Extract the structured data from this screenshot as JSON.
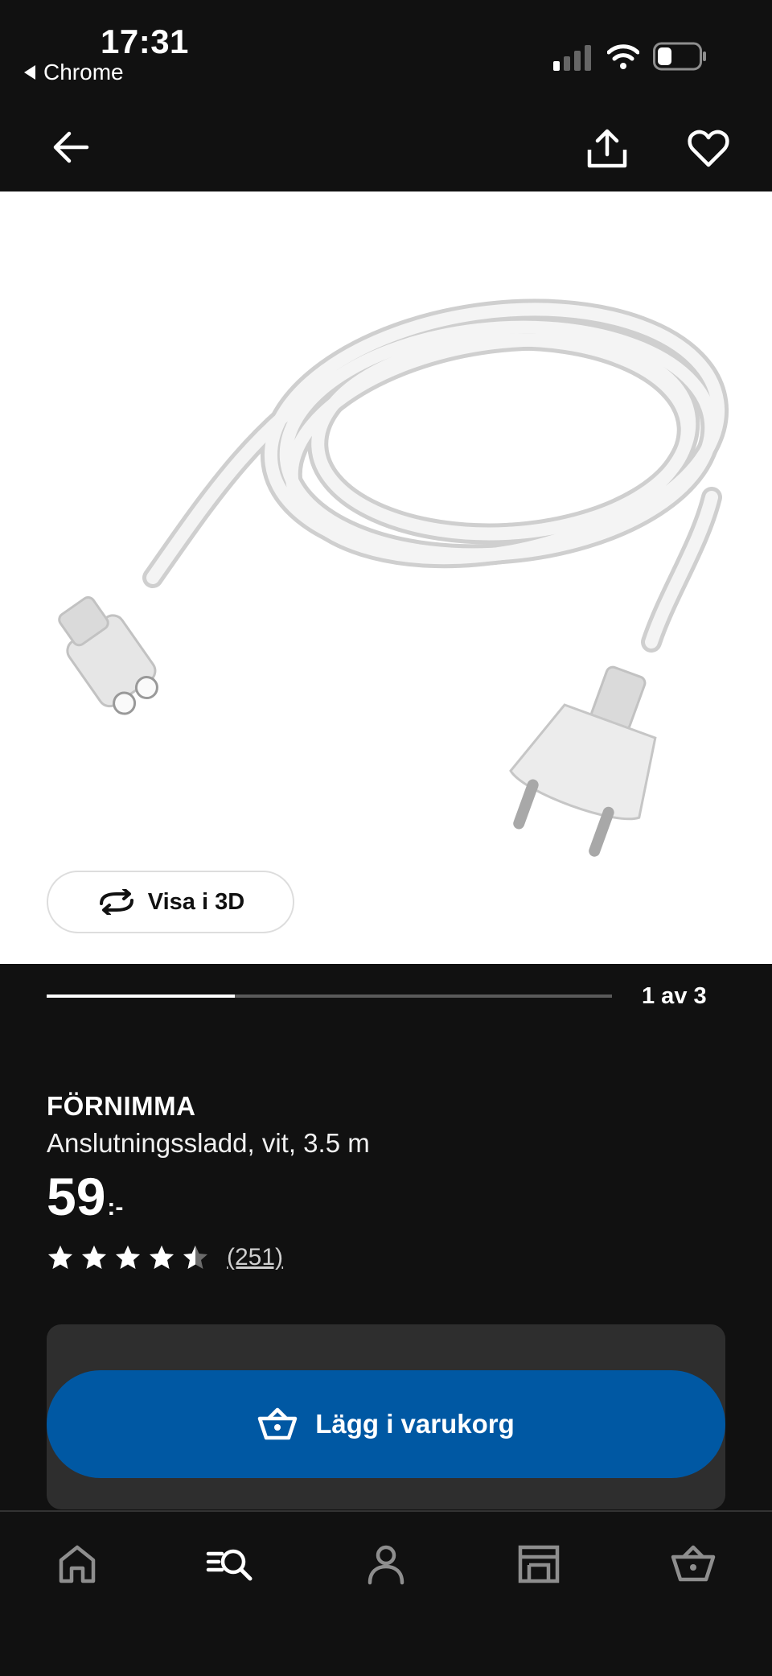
{
  "status_bar": {
    "time": "17:31",
    "back_app": "Chrome",
    "icons": [
      "signal-icon",
      "wifi-icon",
      "battery-icon"
    ]
  },
  "top_nav": {
    "icons": [
      "back-arrow-icon",
      "share-icon",
      "heart-icon"
    ]
  },
  "gallery": {
    "view_3d_label": "Visa i 3D",
    "page_indicator": "1 av 3",
    "current_page": 1,
    "total_pages": 3
  },
  "product": {
    "name": "FÖRNIMMA",
    "description": "Anslutningssladd, vit, 3.5 m",
    "price": "59",
    "price_suffix": ":-",
    "rating": 4.5,
    "rating_max": 5,
    "review_count": "(251)"
  },
  "cart": {
    "add_label": "Lägg i varukorg"
  },
  "tab_bar": {
    "items": [
      "home-icon",
      "search-icon",
      "profile-icon",
      "store-icon",
      "basket-icon"
    ]
  },
  "colors": {
    "background": "#111111",
    "primary_button": "#0058a3",
    "panel": "#2e2e2e"
  }
}
